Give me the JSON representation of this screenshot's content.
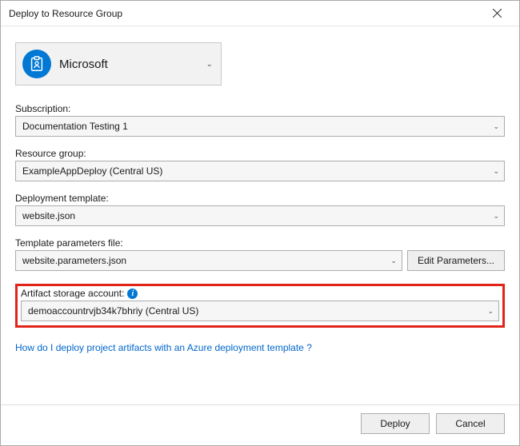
{
  "window": {
    "title": "Deploy to Resource Group"
  },
  "account": {
    "name": "Microsoft"
  },
  "labels": {
    "subscription": "Subscription:",
    "resource_group": "Resource group:",
    "deployment_template": "Deployment template:",
    "template_params": "Template parameters file:",
    "artifact_storage": "Artifact storage account:"
  },
  "values": {
    "subscription": "Documentation Testing 1",
    "resource_group": "ExampleAppDeploy (Central US)",
    "deployment_template": "website.json",
    "template_params": "website.parameters.json",
    "artifact_storage": "demoaccountrvjb34k7bhriy (Central US)"
  },
  "buttons": {
    "edit_params": "Edit Parameters...",
    "deploy": "Deploy",
    "cancel": "Cancel"
  },
  "help_link": "How do I deploy project artifacts with an Azure deployment template ?"
}
